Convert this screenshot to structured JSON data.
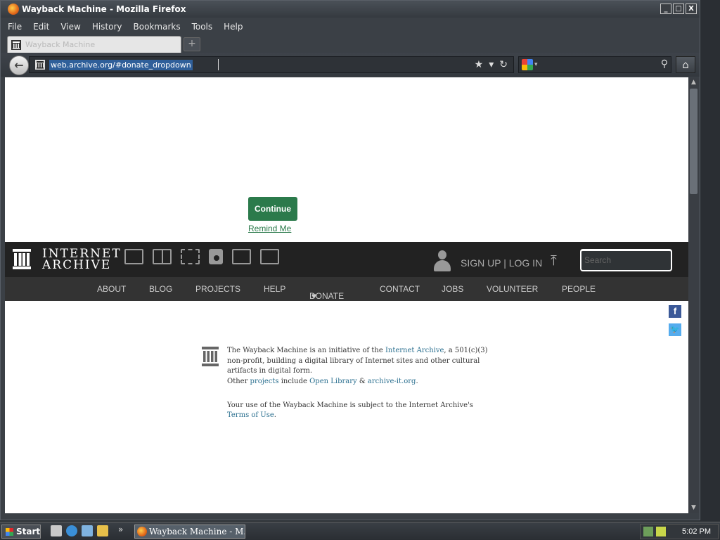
{
  "window": {
    "title": "Wayback Machine - Mozilla Firefox",
    "minimize": "_",
    "maximize": "□",
    "close": "X"
  },
  "menu": [
    "File",
    "Edit",
    "View",
    "History",
    "Bookmarks",
    "Tools",
    "Help"
  ],
  "tab": {
    "label": "Wayback Machine",
    "new_tab": "+"
  },
  "navbar": {
    "url": "web.archive.org/#donate_dropdown",
    "search_placeholder": ""
  },
  "page": {
    "continue_label": "Continue",
    "remind_label": "Remind Me",
    "ia_name_line1": "INTERNET",
    "ia_name_line2": "ARCHIVE",
    "signup_label": "SIGN UP | LOG IN",
    "search_placeholder": "Search",
    "nav": [
      "ABOUT",
      "BLOG",
      "PROJECTS",
      "HELP",
      "DONATE",
      "CONTACT",
      "JOBS",
      "VOLUNTEER",
      "PEOPLE"
    ],
    "wayback": {
      "p1_a": "The Wayback Machine is an initiative of the ",
      "p1_link": "Internet Archive",
      "p1_b": ", a 501(c)(3) non-profit, building a digital library of Internet sites and other cultural artifacts in digital form.",
      "p2_a": "Other ",
      "p2_link1": "projects",
      "p2_b": " include ",
      "p2_link2": "Open Library",
      "p2_c": " & ",
      "p2_link3": "archive-it.org",
      "p2_d": ".",
      "terms_a": "Your use of the Wayback Machine is subject to the Internet Archive's ",
      "terms_link": "Terms of Use",
      "terms_b": "."
    }
  },
  "taskbar": {
    "start_label": "Start",
    "task_label": "Wayback Machine - M...",
    "clock": "5:02 PM",
    "more": "»"
  },
  "colors": {
    "continue_bg": "#2b7a4b",
    "ia_header_bg": "#222222",
    "ia_nav_bg": "#333333",
    "donate_heart": "#e4262b",
    "link": "#2a6f8f"
  }
}
